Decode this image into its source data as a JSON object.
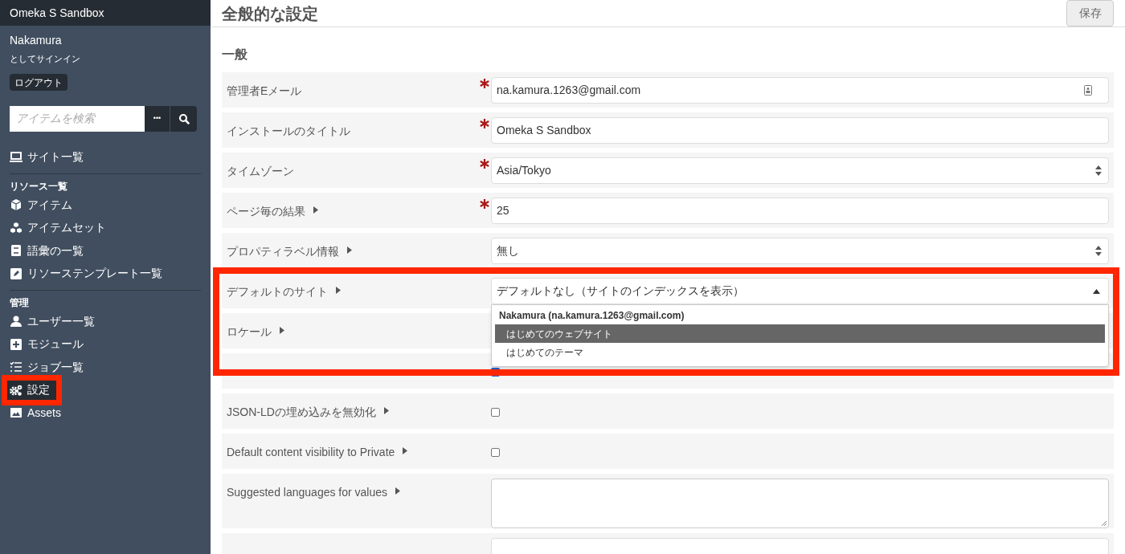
{
  "sidebar": {
    "title": "Omeka S Sandbox",
    "user": "Nakamura",
    "signed_in_as": "としてサインイン",
    "logout": "ログアウト",
    "search": {
      "placeholder": "アイテムを検索",
      "options": "•••"
    },
    "sections": [
      {
        "items": [
          {
            "label": "サイト一覧",
            "highlighted": false
          }
        ]
      },
      {
        "heading": "リソース一覧",
        "items": [
          {
            "label": "アイテム",
            "highlighted": false
          },
          {
            "label": "アイテムセット",
            "highlighted": false
          },
          {
            "label": "語彙の一覧",
            "highlighted": false
          },
          {
            "label": "リソーステンプレート一覧",
            "highlighted": false
          }
        ]
      },
      {
        "heading": "管理",
        "items": [
          {
            "label": "ユーザー一覧",
            "highlighted": false
          },
          {
            "label": "モジュール",
            "highlighted": false
          },
          {
            "label": "ジョブ一覧",
            "highlighted": false
          },
          {
            "label": "設定",
            "highlighted": true
          },
          {
            "label": "Assets",
            "highlighted": false
          }
        ]
      }
    ]
  },
  "page": {
    "title": "全般的な設定",
    "save": "保存",
    "section": "一般",
    "rows": [
      {
        "label": "管理者Eメール",
        "info": false,
        "required": true,
        "kind": "email",
        "value": "na.kamura.1263@gmail.com",
        "highlighted": false
      },
      {
        "label": "インストールのタイトル",
        "info": false,
        "required": true,
        "kind": "text",
        "value": "Omeka S Sandbox",
        "highlighted": false
      },
      {
        "label": "タイムゾーン",
        "info": false,
        "required": true,
        "kind": "select",
        "value": "Asia/Tokyo",
        "highlighted": false
      },
      {
        "label": "ページ毎の結果",
        "info": true,
        "required": true,
        "kind": "text",
        "value": "25",
        "highlighted": false
      },
      {
        "label": "プロパティラベル情報",
        "info": true,
        "required": false,
        "kind": "select",
        "value": "無し",
        "highlighted": false
      },
      {
        "label": "デフォルトのサイト",
        "info": true,
        "required": false,
        "kind": "open-select",
        "value": "デフォルトなし（サイトのインデックスを表示）",
        "highlighted": true,
        "dropdown": {
          "group": "Nakamura (na.kamura.1263@gmail.com)",
          "options": [
            {
              "label": "はじめてのウェブサイト",
              "selected": true
            },
            {
              "label": "はじめてのテーマ",
              "selected": false
            }
          ]
        }
      },
      {
        "label": "ロケール",
        "info": true,
        "required": false,
        "kind": "hidden",
        "highlighted": false
      },
      {
        "kind": "checkbox",
        "checked": true,
        "info": false,
        "required": false,
        "highlighted": false
      },
      {
        "label": "JSON-LDの埋め込みを無効化",
        "info": true,
        "required": false,
        "kind": "checkbox",
        "checked": false,
        "highlighted": false
      },
      {
        "label": "Default content visibility to Private",
        "info": true,
        "required": false,
        "kind": "checkbox",
        "checked": false,
        "highlighted": false
      },
      {
        "label": "Suggested languages for values",
        "info": true,
        "required": false,
        "kind": "textarea",
        "highlighted": false
      },
      {
        "kind": "text",
        "value": null,
        "info": false,
        "required": false,
        "highlighted": false
      }
    ]
  }
}
